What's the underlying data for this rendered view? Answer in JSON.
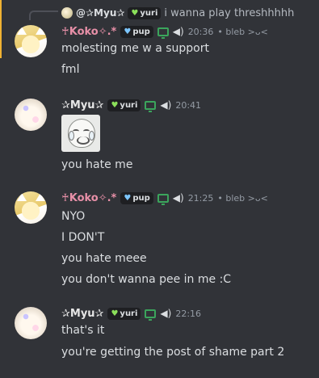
{
  "colors": {
    "background": "#313338",
    "highlight": "#f0b232",
    "koko_name": "#e890a8",
    "green_status": "#3ba55c"
  },
  "messages": [
    {
      "reply": {
        "prefix": "@",
        "name": "✰Myu✰",
        "tag": "yuri",
        "text": "i wanna play threshhhhh"
      },
      "author": "♰Koko✧.*",
      "tag": "pup",
      "time": "20:36",
      "suffix": "• bleb >ᴗ<",
      "lines": [
        "molesting me w a support",
        "fml"
      ]
    },
    {
      "author": "✰Myu✰",
      "tag": "yuri",
      "time": "20:41",
      "lines": [
        "you hate me"
      ]
    },
    {
      "author": "♰Koko✧.*",
      "tag": "pup",
      "time": "21:25",
      "suffix": "• bleb >ᴗ<",
      "lines": [
        "NYO",
        "I DON'T",
        "you hate meee",
        "you don't wanna pee in me :C"
      ]
    },
    {
      "author": "✰Myu✰",
      "tag": "yuri",
      "time": "22:16",
      "lines": [
        "that's it",
        "you're getting the post of shame part 2"
      ]
    }
  ],
  "icons": {
    "heart": "♥",
    "speaker": "🔊"
  }
}
